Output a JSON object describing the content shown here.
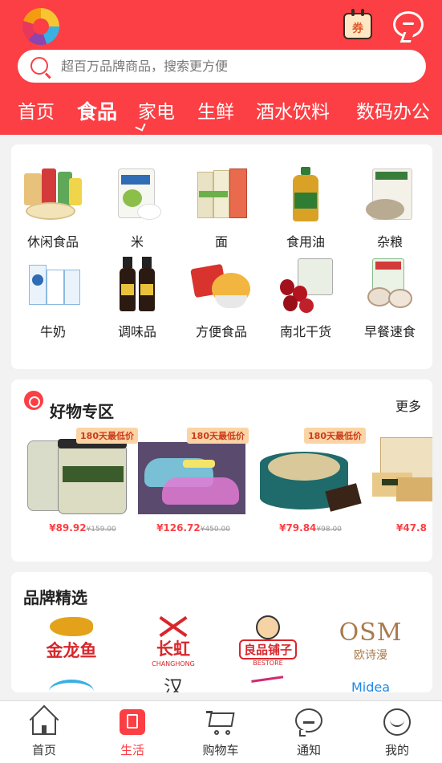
{
  "header": {
    "search_placeholder": "超百万品牌商品，搜索更方便",
    "coupon_icon_text": "券",
    "tabs": [
      "首页",
      "食品",
      "家电",
      "生鲜",
      "酒水饮料",
      "数码办公"
    ],
    "active_tab": "食品"
  },
  "categories": [
    {
      "label": "休闲食品",
      "icon": "snack-pack-icon"
    },
    {
      "label": "米",
      "icon": "rice-bag-icon"
    },
    {
      "label": "面",
      "icon": "noodle-pack-icon"
    },
    {
      "label": "食用油",
      "icon": "oil-bottle-icon"
    },
    {
      "label": "杂粮",
      "icon": "grain-bag-icon"
    },
    {
      "label": "牛奶",
      "icon": "milk-carton-icon"
    },
    {
      "label": "调味品",
      "icon": "sauce-bottle-icon"
    },
    {
      "label": "方便食品",
      "icon": "instant-noodle-icon"
    },
    {
      "label": "南北干货",
      "icon": "dried-dates-icon"
    },
    {
      "label": "早餐速食",
      "icon": "breakfast-bun-icon"
    }
  ],
  "deals": {
    "title": "好物专区",
    "more": "更多",
    "products": [
      {
        "badge": "180天最低价",
        "price": "¥89.92",
        "old_price": "¥159.00",
        "image": "pistachio-jar"
      },
      {
        "badge": "180天最低价",
        "price": "¥126.72",
        "old_price": "¥450.00",
        "image": "led-car-speaker"
      },
      {
        "badge": "180天最低价",
        "price": "¥79.84",
        "old_price": "¥98.00",
        "image": "dark-chocolate-tin"
      },
      {
        "badge": "180天最低价",
        "price": "¥47.8",
        "old_price": "",
        "image": "seaweed-cracker"
      }
    ]
  },
  "brands": {
    "title": "品牌精选",
    "row1": [
      {
        "name": "金龙鱼",
        "sub": "",
        "color": "#d8262b"
      },
      {
        "name": "长虹",
        "sub": "CHANGHONG",
        "color": "#d8262b"
      },
      {
        "name": "良品铺子",
        "sub": "BESTORE",
        "color": "#d8262b"
      },
      {
        "name": "OSM",
        "sub": "欧诗漫",
        "color": "#a97b4d"
      }
    ],
    "row2": [
      {
        "name": "",
        "color": "#3ab0e2"
      },
      {
        "name": "汉",
        "color": "#333333"
      },
      {
        "name": "",
        "color": "#d12a6f"
      },
      {
        "name": "Midea",
        "color": "#1e88e5"
      }
    ]
  },
  "tabbar": [
    {
      "label": "首页",
      "icon": "home-icon"
    },
    {
      "label": "生活",
      "icon": "life-icon"
    },
    {
      "label": "购物车",
      "icon": "cart-icon"
    },
    {
      "label": "通知",
      "icon": "notification-icon"
    },
    {
      "label": "我的",
      "icon": "profile-icon"
    }
  ],
  "colors": {
    "primary": "#fb3f44",
    "badge": "#fbd4a6"
  }
}
